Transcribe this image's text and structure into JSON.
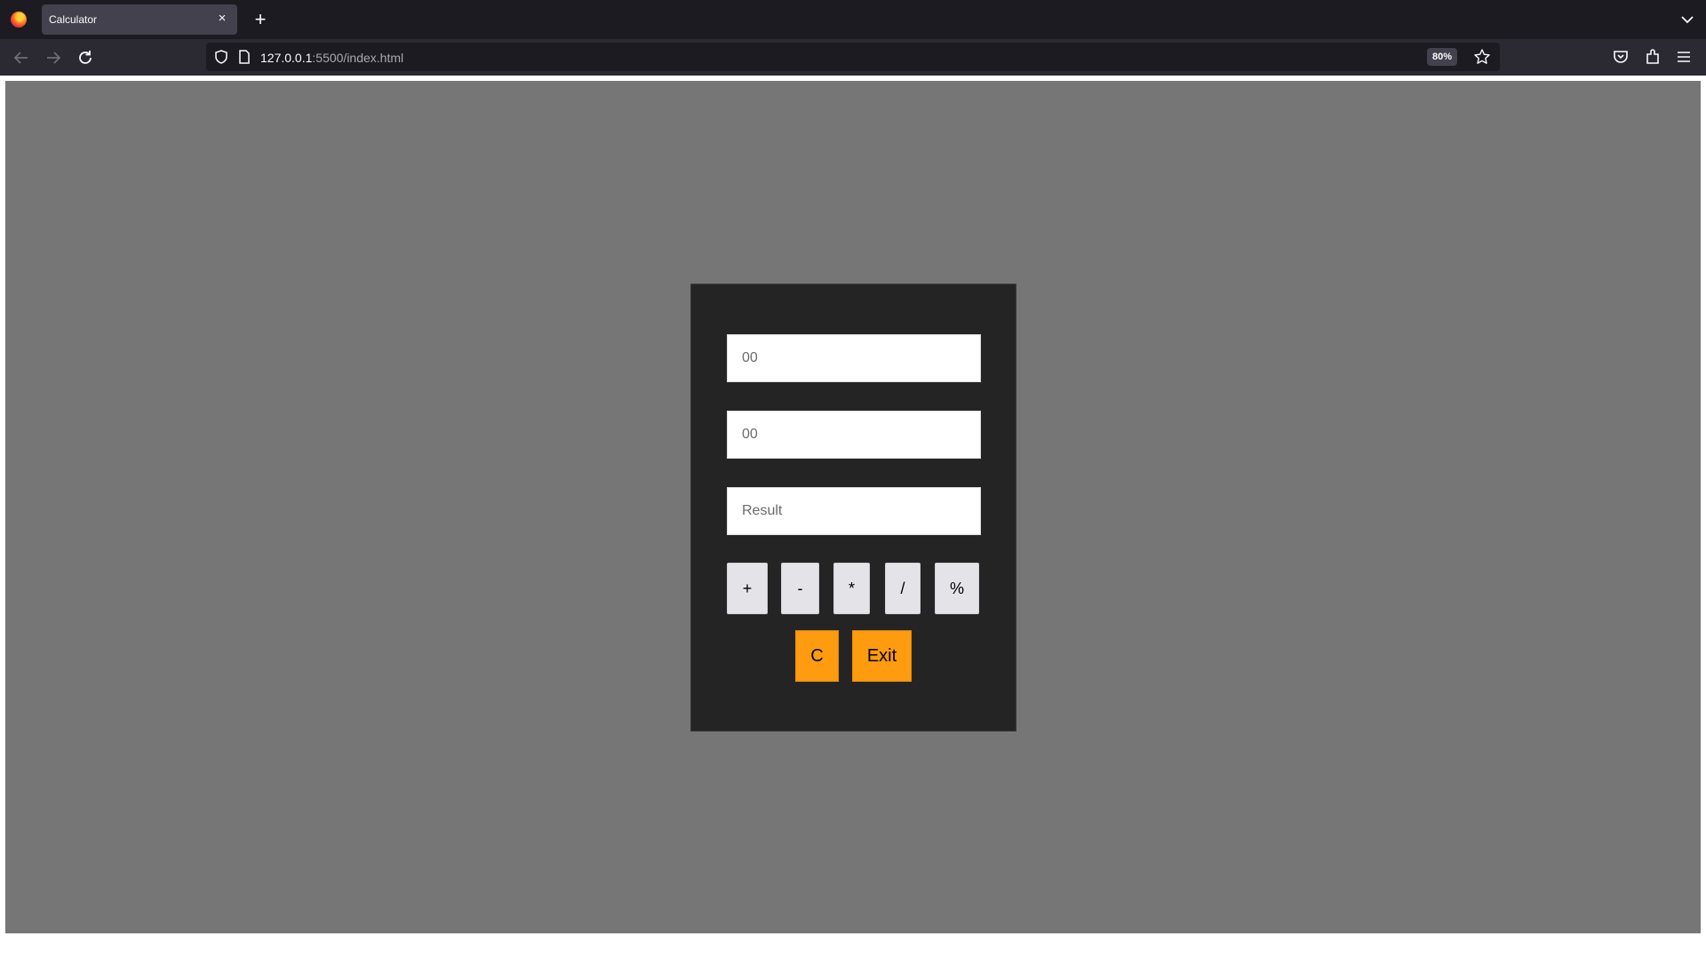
{
  "browser": {
    "tab_title": "Calculator",
    "close_glyph": "×",
    "new_tab_glyph": "+",
    "url_host": "127.0.0.1",
    "url_rest": ":5500/index.html",
    "zoom": "80%"
  },
  "calculator": {
    "first_number_placeholder": "00",
    "second_number_placeholder": "00",
    "result_placeholder": "Result",
    "operators": {
      "add": "+",
      "subtract": "-",
      "multiply": "*",
      "divide": "/",
      "percent": "%"
    },
    "clear_label": "C",
    "exit_label": "Exit"
  },
  "colors": {
    "page_background": "#767676",
    "panel_background": "#252424",
    "operator_button": "#e4e4e8",
    "action_button": "#ff9b0f"
  },
  "icons": [
    "firefox-logo",
    "close-icon",
    "plus-icon",
    "chevron-down-icon",
    "back-arrow-icon",
    "forward-arrow-icon",
    "reload-icon",
    "shield-icon",
    "page-icon",
    "star-icon",
    "pocket-icon",
    "extensions-icon",
    "menu-icon"
  ]
}
